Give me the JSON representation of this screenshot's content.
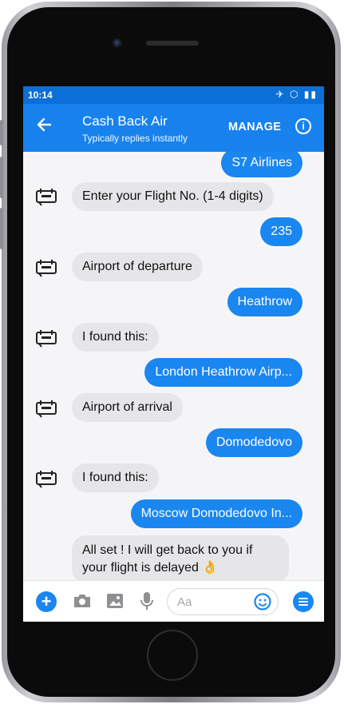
{
  "status_bar": {
    "time": "10:14"
  },
  "header": {
    "title": "Cash Back Air",
    "subtitle": "Typically replies instantly",
    "manage_label": "MANAGE"
  },
  "messages": [
    {
      "from": "user",
      "text": "S7 Airlines"
    },
    {
      "from": "bot",
      "text": "Enter your Flight No. (1-4 digits)"
    },
    {
      "from": "user",
      "text": "235"
    },
    {
      "from": "bot",
      "text": "Airport of departure"
    },
    {
      "from": "user",
      "text": "Heathrow"
    },
    {
      "from": "bot",
      "text": "I found this:"
    },
    {
      "from": "user",
      "text": "London Heathrow Airp..."
    },
    {
      "from": "bot",
      "text": "Airport of arrival"
    },
    {
      "from": "user",
      "text": "Domodedovo"
    },
    {
      "from": "bot",
      "text": "I found this:"
    },
    {
      "from": "user",
      "text": "Moscow Domodedovo In..."
    },
    {
      "from": "bot",
      "text": "All set ! I will get back to you if your flight is delayed 👌"
    }
  ],
  "composer": {
    "placeholder": "Aa"
  },
  "icons": {
    "back": "arrow-left-icon",
    "info": "info-icon",
    "bot_avatar": "plane-bot-icon",
    "add": "plus-icon",
    "camera": "camera-icon",
    "image": "image-icon",
    "mic": "microphone-icon",
    "emoji": "smiley-icon",
    "menu": "menu-icon"
  },
  "colors": {
    "header": "#1782ee",
    "statusbar": "#0a6fd6",
    "user_bubble": "#1a86f0",
    "bot_bubble": "#e6e6e9"
  }
}
